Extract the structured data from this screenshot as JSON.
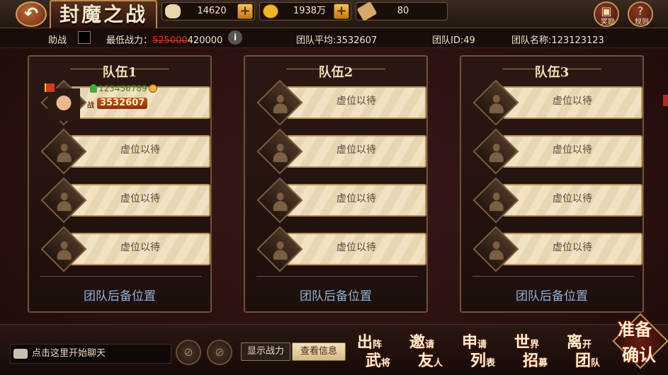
{
  "header": {
    "back": "↶",
    "title": "封魔之战",
    "resources": [
      {
        "name": "ingot",
        "icon": "ingot-icon",
        "value": "14620",
        "plus": "+"
      },
      {
        "name": "coin",
        "icon": "coin-icon",
        "value": "1938万",
        "plus": "+"
      },
      {
        "name": "scroll",
        "icon": "scroll-icon",
        "value": "80"
      }
    ],
    "reward_label": "奖励",
    "rules_label": "规则"
  },
  "info": {
    "assist_label": "助战",
    "min_power_label": "最低战力：",
    "min_power_old": "525000",
    "min_power_new": "420000",
    "info_icon": "i",
    "team_avg": "团队平均:3532607",
    "team_id": "团队ID:49",
    "team_name": "团队名称:123123123"
  },
  "teams": [
    {
      "title": "队伍1",
      "hero": {
        "name": "123456789",
        "power": "3532607",
        "power_prefix": "战"
      },
      "slots": [
        "虚位以待",
        "虚位以待",
        "虚位以待"
      ],
      "reserve": "团队后备位置"
    },
    {
      "title": "队伍2",
      "slots": [
        "虚位以待",
        "虚位以待",
        "虚位以待",
        "虚位以待"
      ],
      "reserve": "团队后备位置"
    },
    {
      "title": "队伍3",
      "slots": [
        "虚位以待",
        "虚位以待",
        "虚位以待",
        "虚位以待"
      ],
      "reserve": "团队后备位置"
    }
  ],
  "footer": {
    "chat_placeholder": "点击这里开始聊天",
    "show_power": "显示战力",
    "view_info": "查看信息",
    "actions": [
      {
        "l1a": "出",
        "l1b": "阵",
        "l2a": "武",
        "l2b": "将"
      },
      {
        "l1a": "邀",
        "l1b": "请",
        "l2a": "友",
        "l2b": "人"
      },
      {
        "l1a": "申",
        "l1b": "请",
        "l2a": "列",
        "l2b": "表"
      },
      {
        "l1a": "世",
        "l1b": "界",
        "l2a": "招",
        "l2b": "募"
      },
      {
        "l1a": "离",
        "l1b": "开",
        "l2a": "团",
        "l2b": "队"
      }
    ],
    "ready": {
      "l1a": "准",
      "l1b": "备",
      "l2a": "确",
      "l2b": "认"
    }
  }
}
